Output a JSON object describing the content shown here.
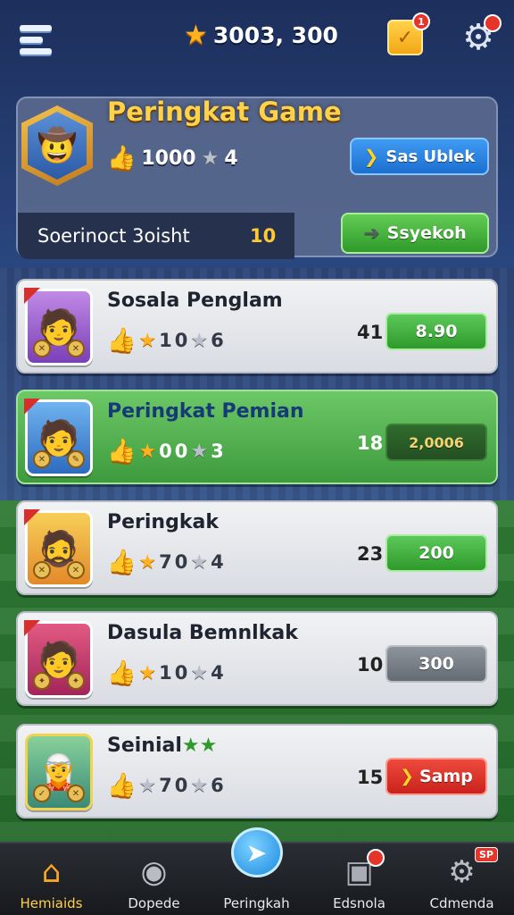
{
  "topbar": {
    "currency_value": "3003, 300",
    "mail_badge": "1",
    "settings_badge": ""
  },
  "profile": {
    "title": "Peringkat Game",
    "likes": "1000",
    "stars": "4",
    "primary_button": "Sas Ublek",
    "score_label": "Soerinoct 3oisht",
    "score_value": "10",
    "secondary_button": "Ssyekoh"
  },
  "rows": [
    {
      "name": "Sosala Penglam",
      "stats_a": "1",
      "stats_b": "0",
      "stats_c": "6",
      "rank": "41",
      "button": "8.90",
      "style": "green"
    },
    {
      "name": "Peringkat Pemian",
      "stats_a": "0",
      "stats_b": "0",
      "stats_c": "3",
      "rank": "18",
      "button": "2,0006",
      "style": "dark"
    },
    {
      "name": "Peringkak",
      "stats_a": "7",
      "stats_b": "0",
      "stats_c": "4",
      "rank": "23",
      "button": "200",
      "style": "green"
    },
    {
      "name": "Dasula Bemnlkak",
      "stats_a": "1",
      "stats_b": "0",
      "stats_c": "4",
      "rank": "10",
      "button": "300",
      "style": "grey"
    },
    {
      "name": "Seinial",
      "stats_a": "7",
      "stats_b": "0",
      "stats_c": "6",
      "rank": "15",
      "button": "Samp",
      "style": "red"
    }
  ],
  "nav": {
    "home": "Hemiaids",
    "second": "Dopede",
    "center": "Peringkah",
    "fourth": "Edsnola",
    "fifth": "Cdmenda",
    "fifth_badge": "SP"
  },
  "colors": {
    "accent_gold": "#ffd24a",
    "primary_blue": "#1c6fd0",
    "success_green": "#2f9a2b",
    "danger_red": "#c9221c"
  }
}
